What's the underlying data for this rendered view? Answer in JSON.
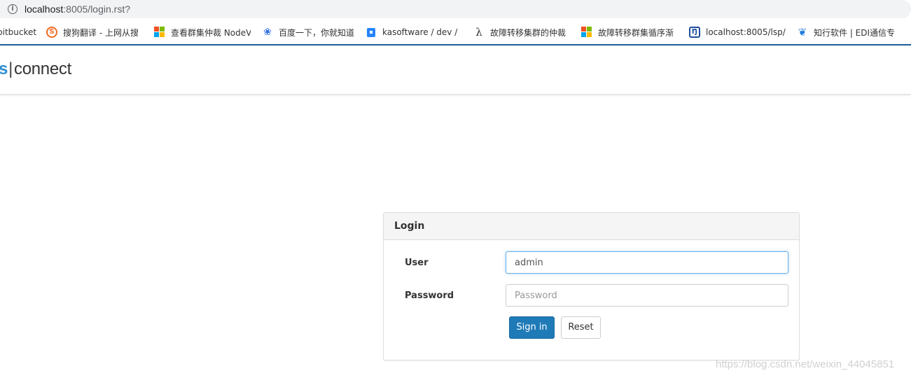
{
  "browser": {
    "url_host": "localhost",
    "url_rest": ":8005/login.rst?"
  },
  "bookmarks": [
    {
      "label": "bitbucket",
      "icon": "none"
    },
    {
      "label": "搜狗翻译 - 上网从搜",
      "icon": "sogou-icon"
    },
    {
      "label": "查看群集仲裁 NodeV",
      "icon": "microsoft-icon"
    },
    {
      "label": "百度一下，你就知道",
      "icon": "baidu-paw-icon"
    },
    {
      "label": "kasoftware / dev / i",
      "icon": "bitbucket-icon"
    },
    {
      "label": "故障转移集群的仲裁",
      "icon": "lambda-icon"
    },
    {
      "label": "故障转移群集循序渐",
      "icon": "microsoft-icon"
    },
    {
      "label": "localhost:8005/lsp/",
      "icon": "fj-icon"
    },
    {
      "label": "知行软件 | EDI通信专",
      "icon": "leaf-icon"
    }
  ],
  "navbar": {
    "brand_prefix": "s",
    "brand_name": "connect"
  },
  "login": {
    "title": "Login",
    "user_label": "User",
    "user_value": "admin",
    "password_label": "Password",
    "password_placeholder": "Password",
    "signin_label": "Sign in",
    "reset_label": "Reset"
  },
  "watermark": "https://blog.csdn.net/weixin_44045851",
  "colors": {
    "accent_rule": "#1a5fa0",
    "primary_button": "#1f7ab8",
    "brand_accent": "#2e8fd0"
  }
}
